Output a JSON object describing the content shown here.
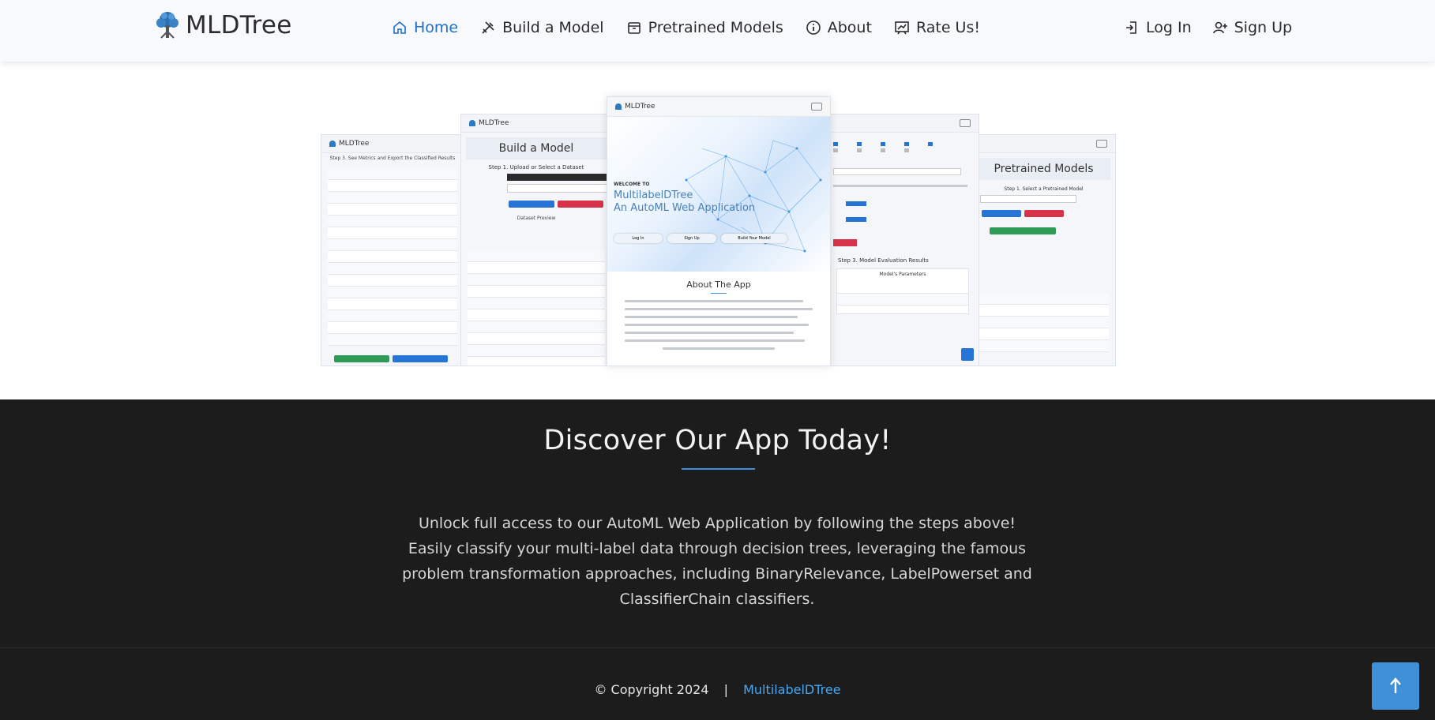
{
  "brand": {
    "name": "MLDTree",
    "logo_icon": "tree-icon"
  },
  "nav": {
    "items": [
      {
        "label": "Home",
        "icon": "home-icon",
        "active": true
      },
      {
        "label": "Build a Model",
        "icon": "tools-icon",
        "active": false
      },
      {
        "label": "Pretrained Models",
        "icon": "box-icon",
        "active": false
      },
      {
        "label": "About",
        "icon": "info-icon",
        "active": false
      },
      {
        "label": "Rate Us!",
        "icon": "chart-icon",
        "active": false
      }
    ],
    "right": [
      {
        "label": "Log In",
        "icon": "login-icon"
      },
      {
        "label": "Sign Up",
        "icon": "person-plus-icon"
      }
    ]
  },
  "showcase": {
    "shots": {
      "left_outer": {
        "app": "MLDTree",
        "heading": "Step 3. See Metrics and Export the Classified Results"
      },
      "left_inner": {
        "app": "MLDTree",
        "title": "Build a Model",
        "heading": "Step 1. Upload or Select a Dataset",
        "sub": "Dataset Preview"
      },
      "center": {
        "app": "MLDTree",
        "welcome": "WELCOME TO",
        "hero_title_1": "MultilabelDTree",
        "hero_title_2": "An AutoML Web Application",
        "buttons": [
          "Log In",
          "Sign Up",
          "Build Your Model"
        ],
        "about_title": "About The App"
      },
      "right_inner": {
        "heading": "Step 3. Model Evaluation Results",
        "table_title": "Model's Parameters"
      },
      "right_outer": {
        "title": "Pretrained Models",
        "heading": "Step 1. Select a Pretrained Model"
      }
    }
  },
  "discover": {
    "title": "Discover Our App Today!",
    "text": "Unlock full access to our AutoML Web Application by following the steps above! Easily classify your multi-label data through decision trees, leveraging the famous problem transformation approaches, including BinaryRelevance, LabelPowerset and ClassifierChain classifiers."
  },
  "footer": {
    "copyright": "© Copyright 2024",
    "separator": "|",
    "brand": "MultilabelDTree"
  },
  "back_to_top": {
    "icon": "arrow-up-icon"
  },
  "colors": {
    "accent": "#1e6fc7",
    "dark_bg": "#1c1c1c",
    "underline": "#3b8ee0",
    "button": "#4090d8"
  }
}
